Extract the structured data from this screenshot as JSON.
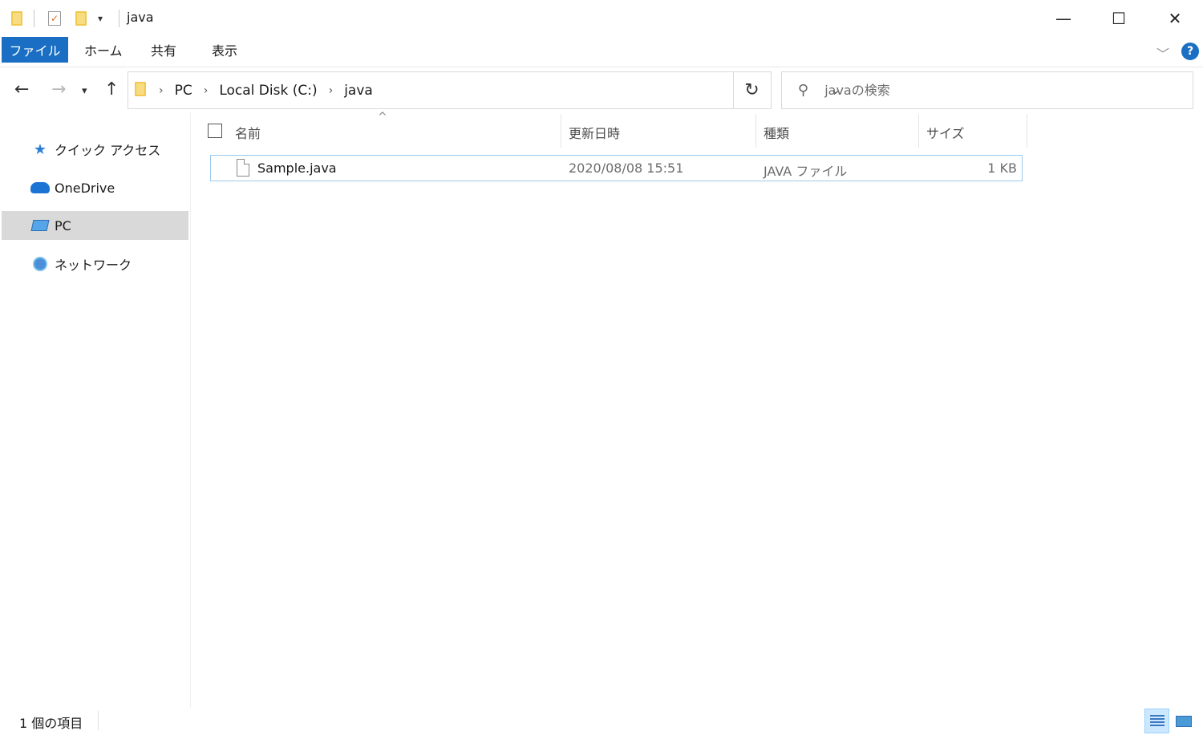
{
  "window": {
    "title": "java",
    "minimize_glyph": "—",
    "maximize_glyph": "☐",
    "close_glyph": "✕"
  },
  "ribbon": {
    "tabs": [
      {
        "label": "ファイル"
      },
      {
        "label": "ホーム"
      },
      {
        "label": "共有"
      },
      {
        "label": "表示"
      }
    ],
    "help_glyph": "?"
  },
  "address": {
    "breadcrumbs": [
      "PC",
      "Local Disk (C:)",
      "java"
    ]
  },
  "search": {
    "placeholder": "javaの検索"
  },
  "sidebar": {
    "items": [
      {
        "label": "クイック アクセス",
        "icon": "star-icon"
      },
      {
        "label": "OneDrive",
        "icon": "cloud-icon"
      },
      {
        "label": "PC",
        "icon": "pc-icon",
        "active": true
      },
      {
        "label": "ネットワーク",
        "icon": "network-icon"
      }
    ]
  },
  "columns": {
    "name": "名前",
    "modified": "更新日時",
    "type": "種類",
    "size": "サイズ"
  },
  "files": [
    {
      "name": "Sample.java",
      "modified": "2020/08/08 15:51",
      "type": "JAVA ファイル",
      "size": "1 KB"
    }
  ],
  "status": {
    "item_count": "1 個の項目"
  },
  "colors": {
    "accent": "#1a6fc4",
    "selection_border": "#99c9ef",
    "sidebar_active": "#d9d9d9"
  }
}
